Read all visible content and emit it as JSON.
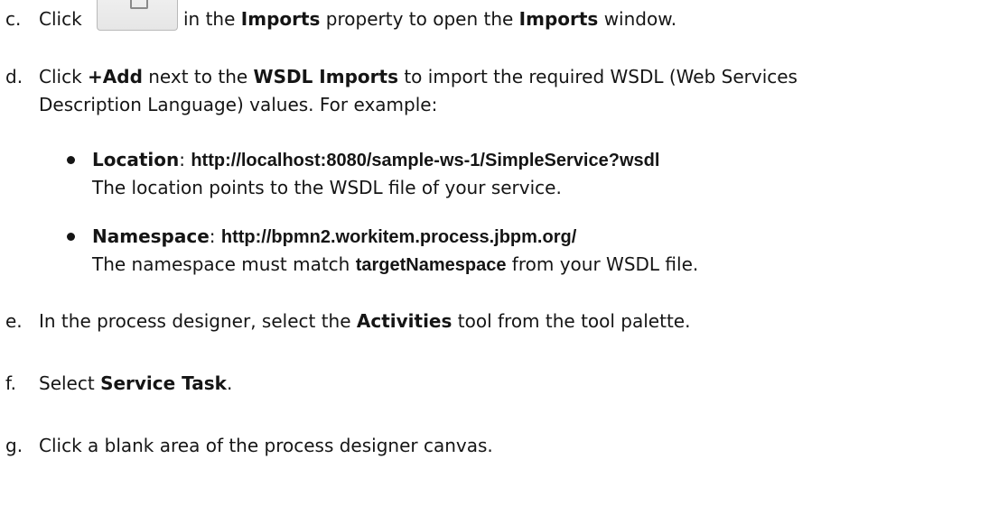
{
  "steps": {
    "c": {
      "marker": "c.",
      "click": "Click",
      "icon": "edit-icon",
      "text1": " in the ",
      "imports": "Imports",
      "text2": " property to open the ",
      "imports2": "Imports",
      "text3": " window."
    },
    "d": {
      "marker": "d.",
      "click": "Click ",
      "add": "+Add",
      "text1": " next to the ",
      "wsdl_imports": "WSDL Imports",
      "text2": " to import the required WSDL (Web Services",
      "line2": "Description Language) values. For example:",
      "bullets": {
        "location": {
          "label": "Location",
          "sep": ": ",
          "value": "http://localhost:8080/sample-ws-1/SimpleService?wsdl",
          "desc": "The location points to the WSDL file of your service."
        },
        "namespace": {
          "label": "Namespace",
          "sep": ": ",
          "value": "http://bpmn2.workitem.process.jbpm.org/",
          "desc_pre": "The namespace must match ",
          "desc_bold": "targetNamespace",
          "desc_post": " from your WSDL file."
        }
      }
    },
    "e": {
      "marker": "e.",
      "text1": "In the process designer, select the ",
      "activities": "Activities",
      "text2": " tool from the tool palette."
    },
    "f": {
      "marker": "f.",
      "text1": "Select ",
      "service_task": "Service Task",
      "text2": "."
    },
    "g": {
      "marker": "g.",
      "text1": "Click a blank area of the process designer canvas."
    }
  }
}
